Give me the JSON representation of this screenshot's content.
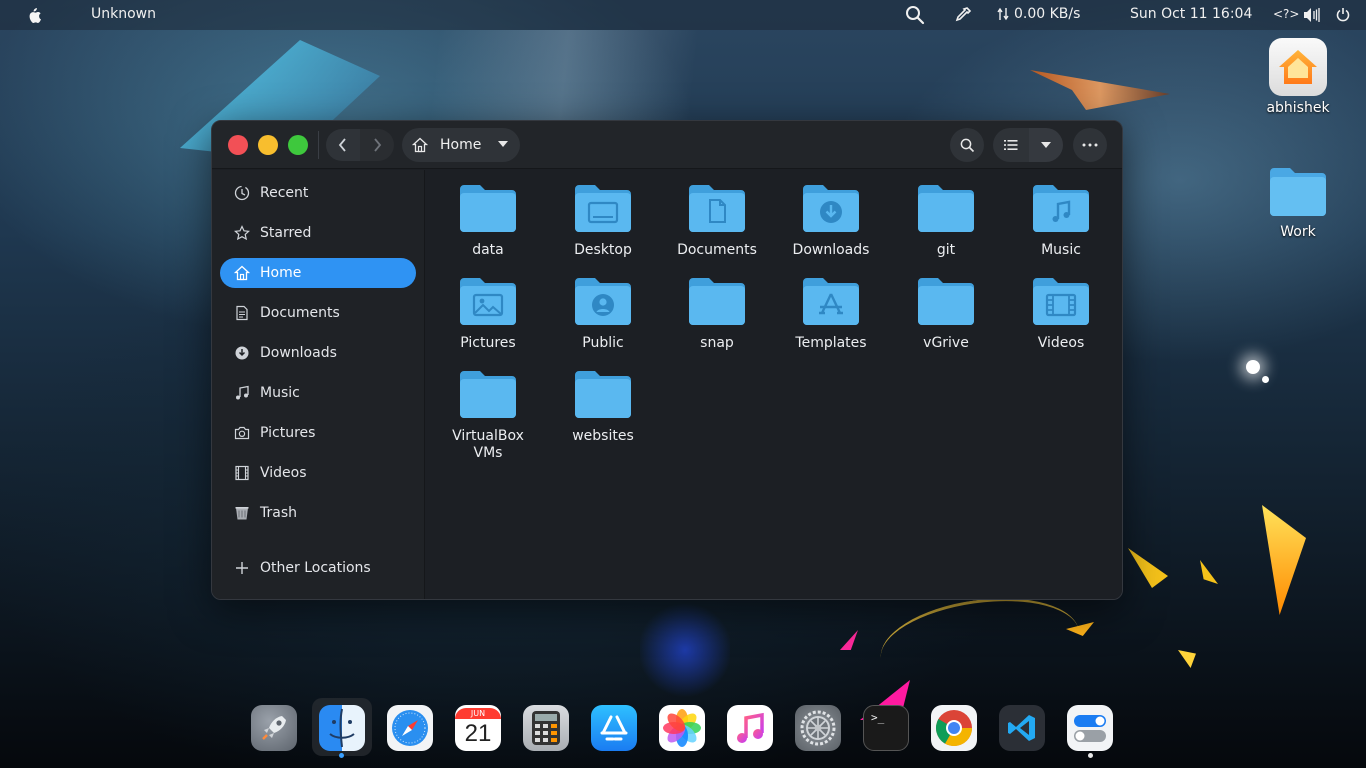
{
  "topbar": {
    "app_name": "Unknown",
    "net_speed": "0.00 KB/s",
    "clock": "Sun Oct 11  16:04",
    "keyboard": "<?>",
    "icons": [
      "apple-icon",
      "search-icon",
      "color-picker-icon",
      "network-arrows-icon",
      "volume-icon",
      "power-icon"
    ]
  },
  "desktop": {
    "icons": [
      {
        "label": "abhishek",
        "icon": "home-folder-icon"
      },
      {
        "label": "Work",
        "icon": "folder-icon"
      }
    ]
  },
  "window": {
    "path_label": "Home",
    "sidebar": [
      {
        "label": "Recent",
        "icon": "clock-icon"
      },
      {
        "label": "Starred",
        "icon": "star-icon"
      },
      {
        "label": "Home",
        "icon": "home-icon",
        "active": true
      },
      {
        "label": "Documents",
        "icon": "document-icon"
      },
      {
        "label": "Downloads",
        "icon": "download-icon"
      },
      {
        "label": "Music",
        "icon": "music-icon"
      },
      {
        "label": "Pictures",
        "icon": "camera-icon"
      },
      {
        "label": "Videos",
        "icon": "film-icon"
      },
      {
        "label": "Trash",
        "icon": "trash-icon"
      },
      {
        "label": "Other Locations",
        "icon": "plus-icon"
      }
    ],
    "folders": [
      {
        "name": "data",
        "emblem": "none"
      },
      {
        "name": "Desktop",
        "emblem": "desktop"
      },
      {
        "name": "Documents",
        "emblem": "document"
      },
      {
        "name": "Downloads",
        "emblem": "download"
      },
      {
        "name": "git",
        "emblem": "none"
      },
      {
        "name": "Music",
        "emblem": "music"
      },
      {
        "name": "Pictures",
        "emblem": "picture"
      },
      {
        "name": "Public",
        "emblem": "user"
      },
      {
        "name": "snap",
        "emblem": "none"
      },
      {
        "name": "Templates",
        "emblem": "template"
      },
      {
        "name": "vGrive",
        "emblem": "none"
      },
      {
        "name": "Videos",
        "emblem": "video"
      },
      {
        "name": "VirtualBox VMs",
        "emblem": "none"
      },
      {
        "name": "websites",
        "emblem": "none"
      }
    ]
  },
  "dock": {
    "calendar_month": "JUN",
    "calendar_day": "21",
    "apps": [
      "launchpad-icon",
      "finder-icon",
      "safari-icon",
      "calendar-icon",
      "calculator-icon",
      "app-store-icon",
      "photos-icon",
      "music-app-icon",
      "system-settings-icon",
      "terminal-icon",
      "chrome-icon",
      "vscode-icon",
      "toggles-icon"
    ]
  },
  "colors": {
    "accent": "#2f93f3",
    "folder": "#5ab8f0",
    "window_bg": "#1c1f24",
    "sidebar_bg": "#1f2226"
  }
}
